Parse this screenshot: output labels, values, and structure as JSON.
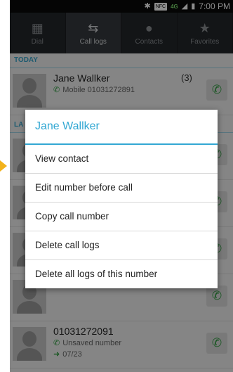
{
  "status": {
    "time": "7:00 PM",
    "nfc": "NFC",
    "network": "4G"
  },
  "tabs": [
    {
      "label": "Dial"
    },
    {
      "label": "Call logs"
    },
    {
      "label": "Contacts"
    },
    {
      "label": "Favorites"
    }
  ],
  "sections": {
    "today": "TODAY",
    "last": "LA"
  },
  "rows": [
    {
      "name": "Jane Wallker",
      "count": "(3)",
      "line1": "Mobile 01031272891"
    },
    {
      "name": "01031272091",
      "line1": "Unsaved number",
      "line2": "07/23"
    }
  ],
  "dialog": {
    "title": "Jane Wallker",
    "items": [
      "View contact",
      "Edit number before call",
      "Copy call number",
      "Delete call logs",
      "Delete all logs of this number"
    ]
  },
  "colors": {
    "accent": "#33a8d3",
    "call_green": "#2e9e3f",
    "arrow_yellow": "#f2b21b"
  }
}
